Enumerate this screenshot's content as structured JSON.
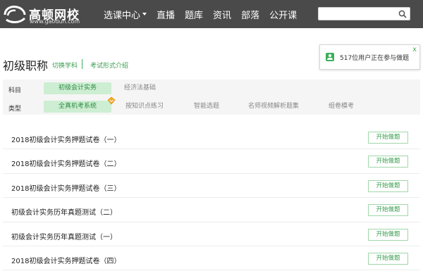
{
  "header": {
    "logo_text": "高顿网校",
    "logo_url": "www.gaodun.com",
    "nav": [
      {
        "label": "选课中心",
        "dropdown": true
      },
      {
        "label": "直播",
        "dropdown": false
      },
      {
        "label": "题库",
        "dropdown": false
      },
      {
        "label": "资讯",
        "dropdown": false
      },
      {
        "label": "部落",
        "dropdown": false
      },
      {
        "label": "公开课",
        "dropdown": false
      }
    ],
    "search": {
      "value": "",
      "placeholder": ""
    }
  },
  "notice": {
    "text": "517位用户正在参与做题",
    "close": "x"
  },
  "title": {
    "text": "初级职称",
    "switch_link": "切换学科",
    "intro_link": "考试形式介绍"
  },
  "filter": {
    "subject_label": "科目",
    "subjects": [
      "初级会计实务",
      "经济法基础"
    ],
    "type_label": "类型",
    "types": [
      "全真机考系统",
      "按知识点练习",
      "智能选题",
      "名师视频解析题集",
      "组卷模考"
    ]
  },
  "exams": [
    {
      "title": "2018初级会计实务押题试卷（一）",
      "button": "开始做题"
    },
    {
      "title": "2018初级会计实务押题试卷（二）",
      "button": "开始做题"
    },
    {
      "title": "2018初级会计实务押题试卷（三）",
      "button": "开始做题"
    },
    {
      "title": "初级会计实务历年真题测试（二）",
      "button": "开始做题"
    },
    {
      "title": "初级会计实务历年真题测试（一）",
      "button": "开始做题"
    },
    {
      "title": "2018初级会计实务押题试卷（四）",
      "button": "开始做题"
    }
  ],
  "colors": {
    "accent": "#3fae5b",
    "header": "#4a4a4a",
    "chip_bg": "#cdeed2"
  },
  "icons": {
    "search": "search-icon",
    "logo": "logo-icon",
    "notice": "user-icon",
    "badge": "diamond-badge-icon"
  }
}
